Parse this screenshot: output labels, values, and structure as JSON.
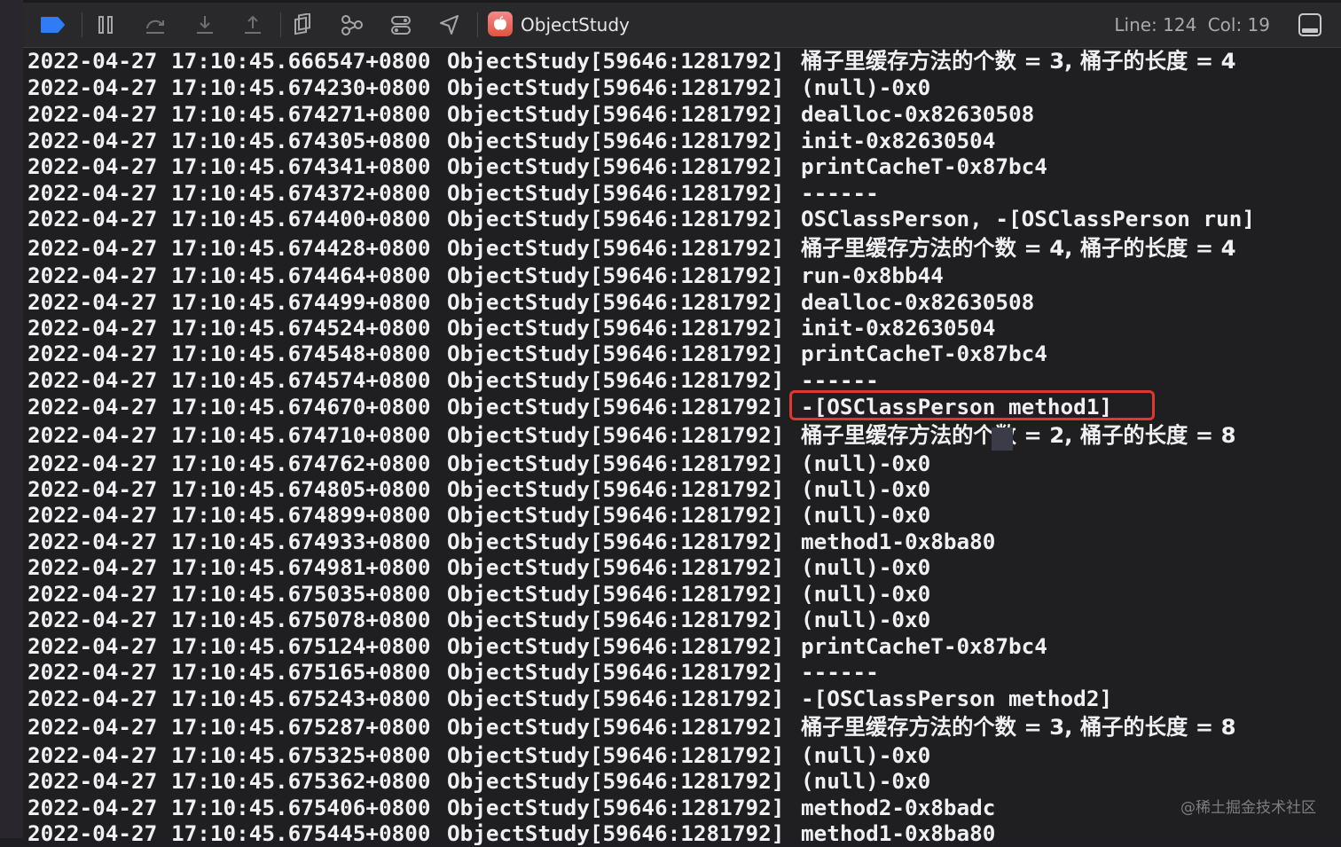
{
  "toolbar": {
    "app_name": "ObjectStudy",
    "line_label": "Line: 124",
    "col_label": "Col: 19"
  },
  "log": {
    "date": "2022-04-27",
    "process": "ObjectStudy[59646:1281792]",
    "rows": [
      {
        "time": "17:10:45.666547+0800",
        "message": "桶子里缓存方法的个数 = 3, 桶子的长度 = 4"
      },
      {
        "time": "17:10:45.674230+0800",
        "message": "(null)-0x0"
      },
      {
        "time": "17:10:45.674271+0800",
        "message": "dealloc-0x82630508"
      },
      {
        "time": "17:10:45.674305+0800",
        "message": "init-0x82630504"
      },
      {
        "time": "17:10:45.674341+0800",
        "message": "printCacheT-0x87bc4"
      },
      {
        "time": "17:10:45.674372+0800",
        "message": "------"
      },
      {
        "time": "17:10:45.674400+0800",
        "message": "OSClassPerson, -[OSClassPerson run]"
      },
      {
        "time": "17:10:45.674428+0800",
        "message": "桶子里缓存方法的个数 = 4, 桶子的长度 = 4"
      },
      {
        "time": "17:10:45.674464+0800",
        "message": "run-0x8bb44"
      },
      {
        "time": "17:10:45.674499+0800",
        "message": "dealloc-0x82630508"
      },
      {
        "time": "17:10:45.674524+0800",
        "message": "init-0x82630504"
      },
      {
        "time": "17:10:45.674548+0800",
        "message": "printCacheT-0x87bc4"
      },
      {
        "time": "17:10:45.674574+0800",
        "message": "------"
      },
      {
        "time": "17:10:45.674670+0800",
        "message": "-[OSClassPerson method1]"
      },
      {
        "time": "17:10:45.674710+0800",
        "message": "桶子里缓存方法的个数 = 2, 桶子的长度 = 8"
      },
      {
        "time": "17:10:45.674762+0800",
        "message": "(null)-0x0"
      },
      {
        "time": "17:10:45.674805+0800",
        "message": "(null)-0x0"
      },
      {
        "time": "17:10:45.674899+0800",
        "message": "(null)-0x0"
      },
      {
        "time": "17:10:45.674933+0800",
        "message": "method1-0x8ba80"
      },
      {
        "time": "17:10:45.674981+0800",
        "message": "(null)-0x0"
      },
      {
        "time": "17:10:45.675035+0800",
        "message": "(null)-0x0"
      },
      {
        "time": "17:10:45.675078+0800",
        "message": "(null)-0x0"
      },
      {
        "time": "17:10:45.675124+0800",
        "message": "printCacheT-0x87bc4"
      },
      {
        "time": "17:10:45.675165+0800",
        "message": "------"
      },
      {
        "time": "17:10:45.675243+0800",
        "message": "-[OSClassPerson method2]"
      },
      {
        "time": "17:10:45.675287+0800",
        "message": "桶子里缓存方法的个数 = 3, 桶子的长度 = 8"
      },
      {
        "time": "17:10:45.675325+0800",
        "message": "(null)-0x0"
      },
      {
        "time": "17:10:45.675362+0800",
        "message": "(null)-0x0"
      },
      {
        "time": "17:10:45.675406+0800",
        "message": "method2-0x8badc"
      },
      {
        "time": "17:10:45.675445+0800",
        "message": "method1-0x8ba80"
      }
    ]
  },
  "watermark": "@稀土掘金技术社区",
  "colors": {
    "highlight_box": "#e0382c",
    "accent": "#2f7cf6"
  }
}
